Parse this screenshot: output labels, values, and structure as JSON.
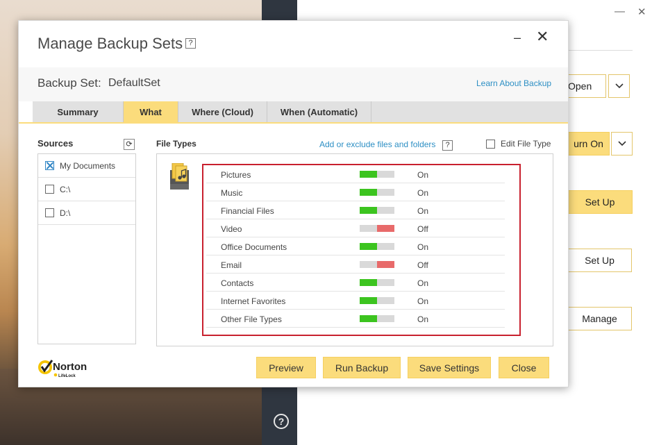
{
  "background_app": {
    "buttons": [
      "Open",
      "urn On",
      "Set Up",
      "Set Up",
      "Manage"
    ],
    "help_symbol": "?"
  },
  "dialog": {
    "title": "Manage Backup Sets",
    "help_symbol": "?",
    "minimize_symbol": "–",
    "close_symbol": "✕",
    "backup_set_label": "Backup Set:",
    "backup_set_value": "DefaultSet",
    "learn_link": "Learn About Backup",
    "tabs": [
      "Summary",
      "What",
      "Where (Cloud)",
      "When (Automatic)"
    ],
    "active_tab": "What",
    "sources": {
      "title": "Sources",
      "items": [
        {
          "label": "My Documents",
          "checked": true
        },
        {
          "label": "C:\\",
          "checked": false
        },
        {
          "label": "D:\\",
          "checked": false
        }
      ]
    },
    "file_types": {
      "title": "File Types",
      "add_link": "Add or exclude files and folders",
      "edit_label": "Edit File Type",
      "rows": [
        {
          "name": "Pictures",
          "state": "On"
        },
        {
          "name": "Music",
          "state": "On"
        },
        {
          "name": "Financial Files",
          "state": "On"
        },
        {
          "name": "Video",
          "state": "Off"
        },
        {
          "name": "Office Documents",
          "state": "On"
        },
        {
          "name": "Email",
          "state": "Off"
        },
        {
          "name": "Contacts",
          "state": "On"
        },
        {
          "name": "Internet Favorites",
          "state": "On"
        },
        {
          "name": "Other File Types",
          "state": "On"
        }
      ]
    },
    "logo": {
      "brand": "Norton",
      "sub": "LifeLock"
    },
    "buttons": {
      "preview": "Preview",
      "run_backup": "Run Backup",
      "save_settings": "Save Settings",
      "close": "Close"
    }
  },
  "colors": {
    "accent_yellow": "#fbdc7c",
    "on_green": "#3cc41f",
    "off_red": "#e86a6a",
    "link_blue": "#2d8fc4",
    "highlight_red": "#c8202e"
  }
}
